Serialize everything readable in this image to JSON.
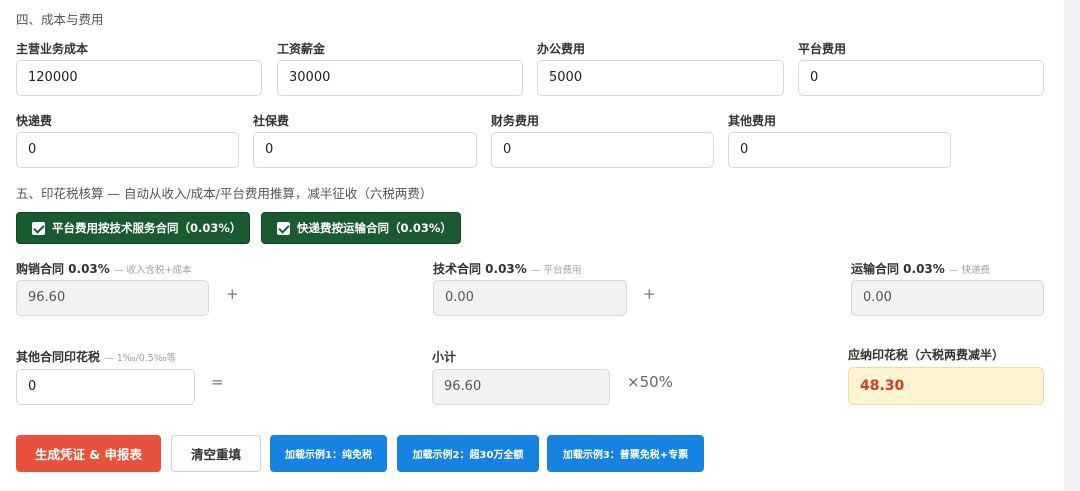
{
  "costs": {
    "section_title": "四、成本与费用",
    "main_cost": {
      "label": "主营业务成本",
      "value": "120000"
    },
    "salary": {
      "label": "工资薪金",
      "value": "30000"
    },
    "office": {
      "label": "办公费用",
      "value": "5000"
    },
    "platform": {
      "label": "平台费用",
      "value": "0"
    },
    "express": {
      "label": "快递费",
      "value": "0"
    },
    "social": {
      "label": "社保费",
      "value": "0"
    },
    "finance": {
      "label": "财务费用",
      "value": "0"
    },
    "other": {
      "label": "其他费用",
      "value": "0"
    }
  },
  "stamp": {
    "section_title": "五、印花税核算 — 自动从收入/成本/平台费用推算，减半征收（六税两费）",
    "toggle_platform": "平台费用按技术服务合同（0.03%）",
    "toggle_express": "快递费按运输合同（0.03%）",
    "sales": {
      "label": "购销合同 0.03%",
      "hint": "— 收入含税+成本",
      "value": "96.60"
    },
    "tech": {
      "label": "技术合同 0.03%",
      "hint": "— 平台费用",
      "value": "0.00"
    },
    "transport": {
      "label": "运输合同 0.03%",
      "hint": "— 快递费",
      "value": "0.00"
    },
    "other": {
      "label": "其他合同印花税",
      "hint": "— 1‰/0.5‰等",
      "value": "0"
    },
    "subtotal": {
      "label": "小计",
      "value": "96.60"
    },
    "payable": {
      "label": "应纳印花税（六税两费减半）",
      "value": "48.30"
    },
    "plus": "+",
    "equals": "=",
    "multiplier": "×50%"
  },
  "actions": {
    "generate": "生成凭证 & 申报表",
    "reset": "清空重填",
    "example1": "加载示例1：纯免税",
    "example2": "加载示例2：超30万全额",
    "example3": "加载示例3：普票免税+专票"
  },
  "colors": {
    "primary_green": "#1a5a30",
    "action_red": "#e8523d",
    "example_blue": "#1683e3",
    "highlight_bg": "#fff3d1",
    "highlight_text": "#d83b22"
  }
}
